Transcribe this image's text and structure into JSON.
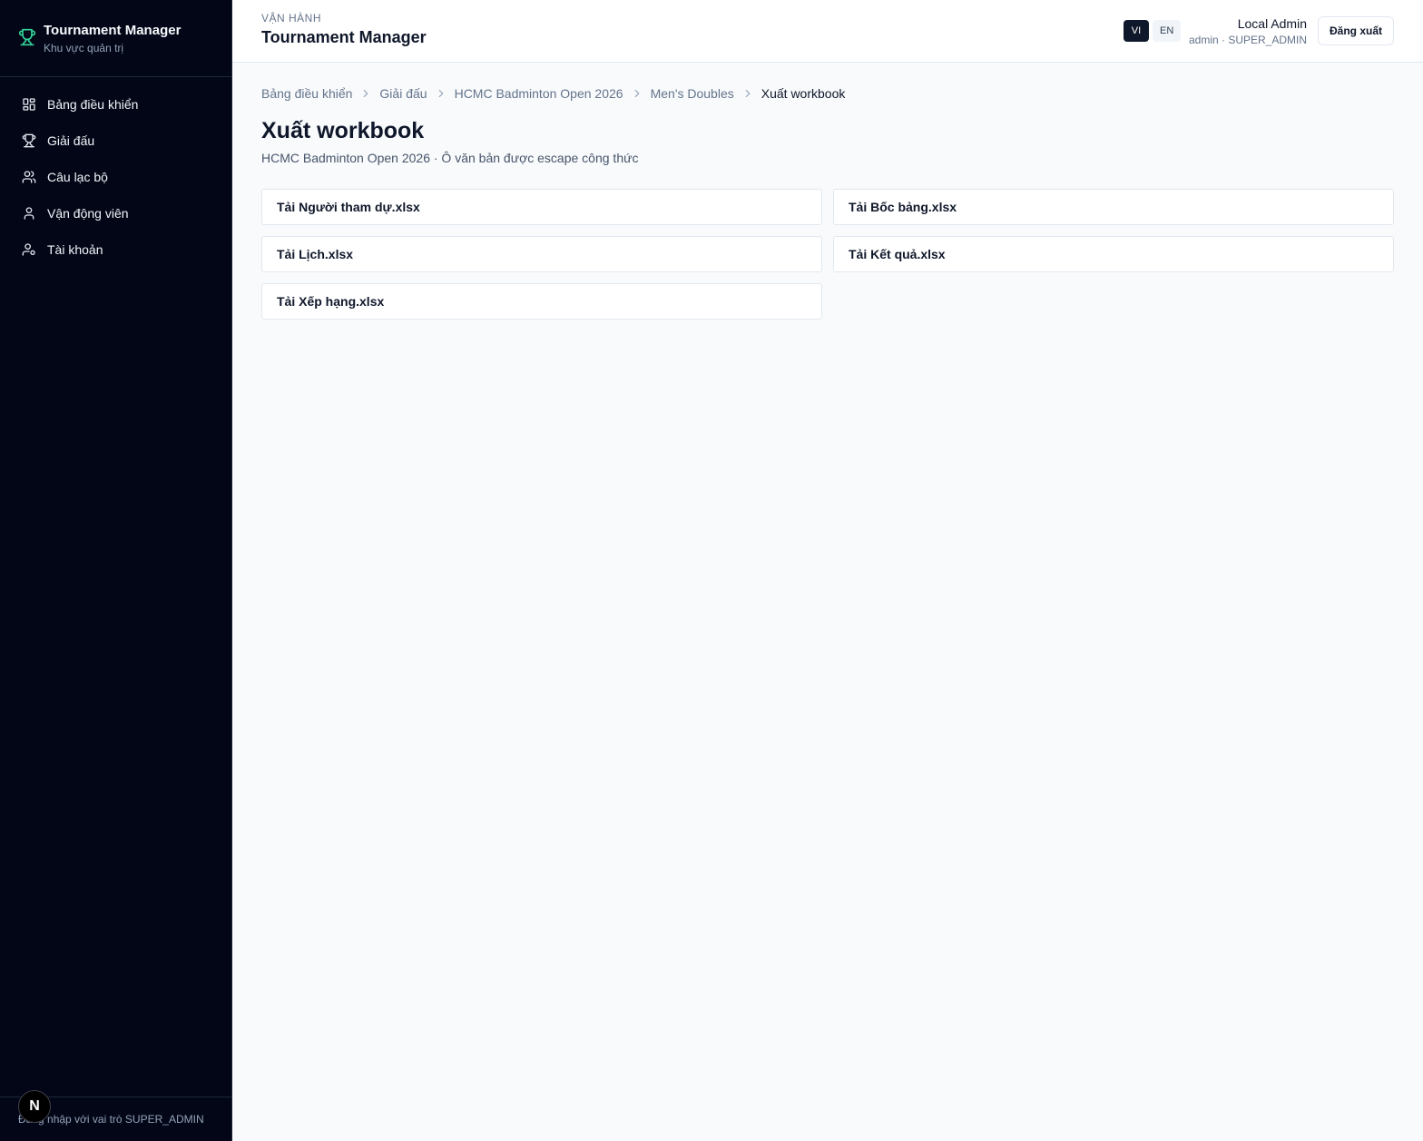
{
  "sidebar": {
    "brand_title": "Tournament Manager",
    "brand_subtitle": "Khu vực quản trị",
    "items": [
      {
        "label": "Bảng điều khiển",
        "icon": "dashboard-icon"
      },
      {
        "label": "Giải đấu",
        "icon": "trophy-icon"
      },
      {
        "label": "Câu lạc bộ",
        "icon": "users-icon"
      },
      {
        "label": "Vận động viên",
        "icon": "user-icon"
      },
      {
        "label": "Tài khoản",
        "icon": "user-cog-icon"
      }
    ],
    "footer": "Đăng nhập với vai trò SUPER_ADMIN",
    "badge": "N"
  },
  "header": {
    "eyebrow": "VẬN HÀNH",
    "title": "Tournament Manager",
    "lang_vi": "VI",
    "lang_en": "EN",
    "user_name": "Local Admin",
    "user_role": "admin · SUPER_ADMIN",
    "logout_label": "Đăng xuất"
  },
  "breadcrumb": [
    "Bảng điều khiển",
    "Giải đấu",
    "HCMC Badminton Open 2026",
    "Men's Doubles",
    "Xuất workbook"
  ],
  "page": {
    "title": "Xuất workbook",
    "subtitle": "HCMC Badminton Open 2026 · Ô văn bản được escape công thức"
  },
  "downloads": [
    "Tải Người tham dự.xlsx",
    "Tải Bốc bảng.xlsx",
    "Tải Lịch.xlsx",
    "Tải Kết quả.xlsx",
    "Tải Xếp hạng.xlsx"
  ],
  "colors": {
    "sidebar_bg": "#020617",
    "accent": "#34d399",
    "page_bg": "#f8fafc"
  }
}
